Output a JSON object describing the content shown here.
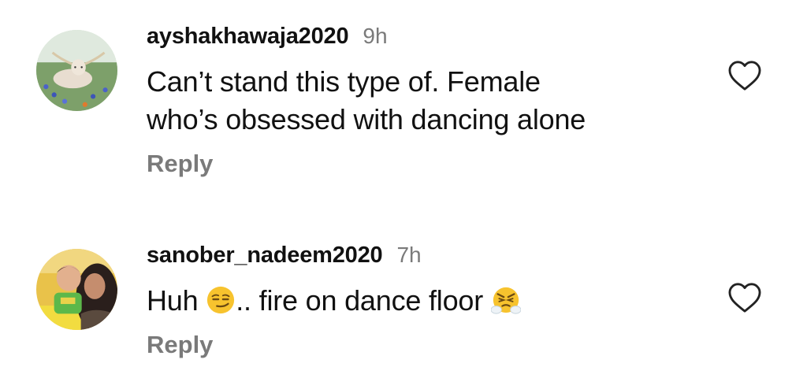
{
  "comments": [
    {
      "username": "ayshakhawaja2020",
      "time": "9h",
      "text_line1": "Can’t stand this type of. Female",
      "text_line2": "who’s obsessed with dancing alone",
      "reply_label": "Reply",
      "avatar_icon": "longhorn-bull-in-flower-field",
      "like_icon": "heart-outline-icon"
    },
    {
      "username": "sanober_nadeem2020",
      "time": "7h",
      "text_part1": "Huh ",
      "emoji1": "smirking-face",
      "text_part2": ".. fire on dance floor ",
      "emoji2": "face-with-steam-from-nose",
      "reply_label": "Reply",
      "avatar_icon": "woman-with-child-photo",
      "like_icon": "heart-outline-icon"
    }
  ],
  "colors": {
    "text": "#111111",
    "secondary": "#7a7a7a",
    "background": "#ffffff"
  }
}
